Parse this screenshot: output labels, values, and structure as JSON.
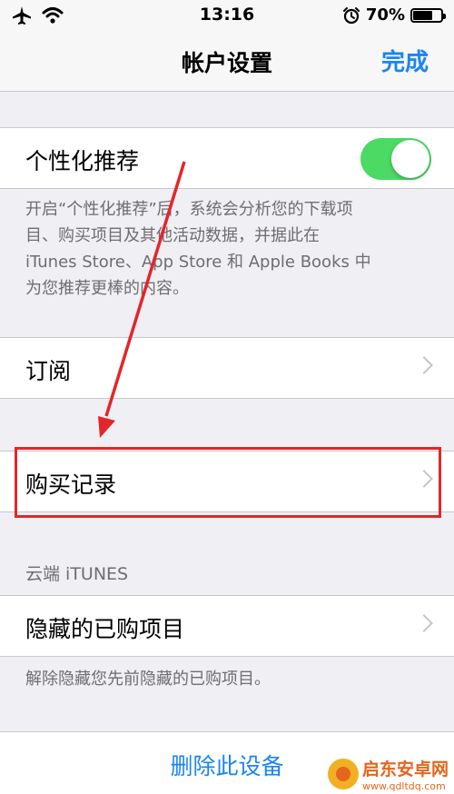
{
  "status_bar": {
    "time": "13:16",
    "battery_percent": "70%",
    "battery_level": 0.7
  },
  "nav": {
    "title": "帐户设置",
    "done_label": "完成"
  },
  "personalized": {
    "label": "个性化推荐",
    "enabled": true,
    "footnote_lines": [
      "开启“个性化推荐”后，系统会分析您的下载项",
      "目、购买项目及其他活动数据，并据此在",
      "iTunes Store、App Store 和 Apple Books 中",
      "为您推荐更棒的内容。"
    ]
  },
  "subscriptions": {
    "label": "订阅"
  },
  "purchase_history": {
    "label": "购买记录"
  },
  "cloud_section": {
    "header": "云端 iTUNES",
    "hidden_purchases_label": "隐藏的已购项目",
    "footnote": "解除隐藏您先前隐藏的已购项目。"
  },
  "delete_device": {
    "label": "删除此设备"
  },
  "watermark": {
    "name": "启东安卓网",
    "url": "www.qdltdq.com"
  },
  "colors": {
    "accent": "#1a84f5",
    "toggle_on": "#4cd964",
    "annotation": "#e3262a"
  }
}
